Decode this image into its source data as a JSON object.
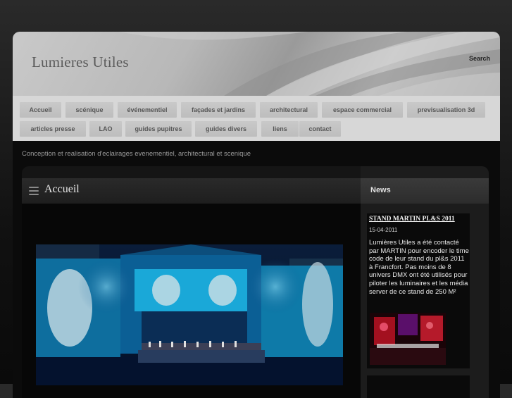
{
  "header": {
    "site_title": "Lumieres Utiles",
    "search_label": "Search"
  },
  "nav": {
    "row1": [
      "Accueil",
      "scénique",
      "événementiel",
      "façades et jardins",
      "architectural",
      "espace commercial",
      "previsualisation 3d"
    ],
    "row2": [
      "articles presse",
      "LAO",
      "guides pupitres",
      "guides divers",
      "liens",
      "contact"
    ]
  },
  "tagline": "Conception et realisation d'eclairages evenementiel, architectural et scenique",
  "main": {
    "title": "Accueil",
    "image_subject": "illuminated castle facade with projections and stage"
  },
  "sidebar": {
    "title": "News",
    "news": {
      "title": "STAND MARTIN PL&S 2011",
      "date": "15-04-2011",
      "text": "Lumières Utiles a été contacté par MARTIN pour encoder le time code de leur stand du pl&s 2011 à Francfort. Pas moins de 8 univers DMX ont été utilisés pour piloter les luminaires et les média server de ce stand de 250 M²"
    }
  },
  "colors": {
    "page_bg": "#111111",
    "header_silver": "#b8b8b8",
    "nav_bg": "#d7d7d7",
    "nav_item_bg": "#c4c4c4",
    "accent_cyan": "#1ec8ff"
  },
  "icons": [
    "menu-icon"
  ]
}
